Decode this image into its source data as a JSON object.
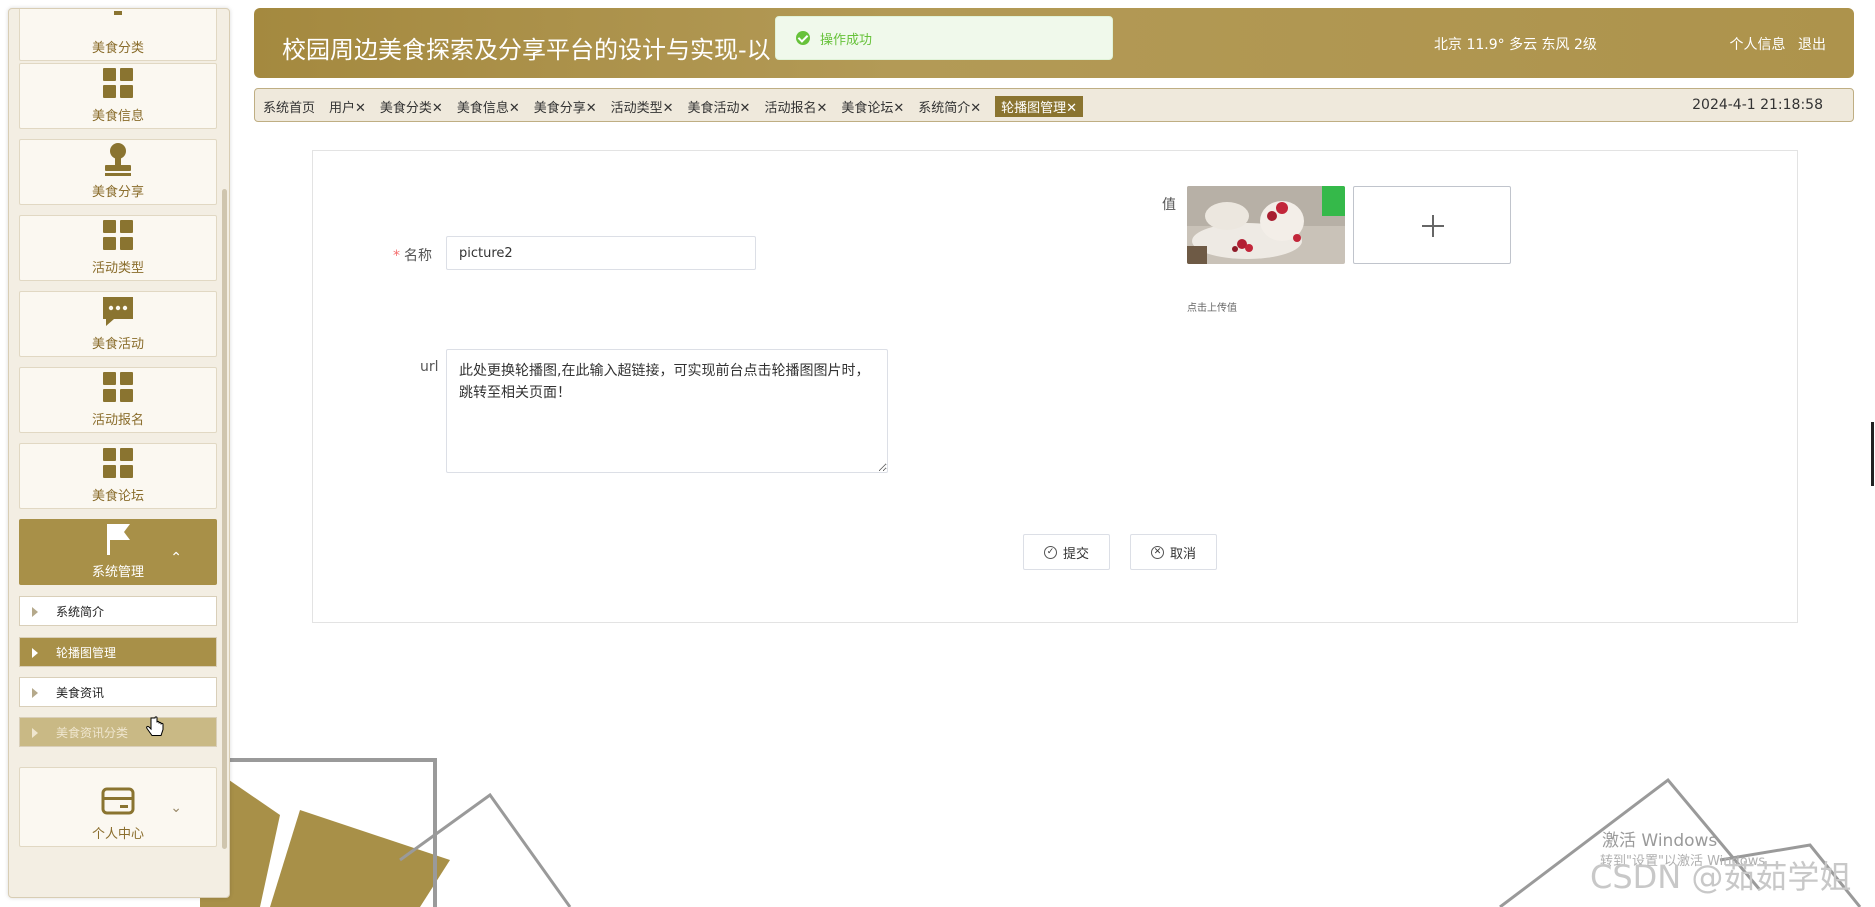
{
  "header": {
    "title": "校园周边美食探索及分享平台的设计与实现-以",
    "weather": "北京  11.9°  多云  东风  2级",
    "profile_link": "个人信息",
    "logout_link": "退出"
  },
  "toast": {
    "message": "操作成功"
  },
  "tabs": [
    {
      "label": "系统首页"
    },
    {
      "label": "用户✕"
    },
    {
      "label": "美食分类✕"
    },
    {
      "label": "美食信息✕"
    },
    {
      "label": "美食分享✕"
    },
    {
      "label": "活动类型✕"
    },
    {
      "label": "美食活动✕"
    },
    {
      "label": "活动报名✕"
    },
    {
      "label": "美食论坛✕"
    },
    {
      "label": "系统简介✕"
    },
    {
      "label": "轮播图管理✕"
    }
  ],
  "datetime": "2024-4-1 21:18:58",
  "sidebar": {
    "items": [
      {
        "label": "美食分类",
        "icon": "menu-icon"
      },
      {
        "label": "美食信息",
        "icon": "grid-icon"
      },
      {
        "label": "美食分享",
        "icon": "stamp-icon"
      },
      {
        "label": "活动类型",
        "icon": "grid-icon"
      },
      {
        "label": "美食活动",
        "icon": "chat-icon"
      },
      {
        "label": "活动报名",
        "icon": "grid-icon"
      },
      {
        "label": "美食论坛",
        "icon": "grid-icon"
      },
      {
        "label": "系统管理",
        "icon": "flag-icon",
        "chevron": "⌃"
      },
      {
        "label": "个人中心",
        "icon": "card-icon",
        "chevron": "⌄"
      }
    ],
    "sub_items": [
      {
        "label": "系统简介"
      },
      {
        "label": "轮播图管理"
      },
      {
        "label": "美食资讯"
      },
      {
        "label": "美食资讯分类"
      }
    ]
  },
  "form": {
    "name_label": "名称",
    "required_mark": "*",
    "name_value": "picture2",
    "url_label": "url",
    "url_value": "此处更换轮播图,在此输入超链接，可实现前台点击轮播图图片时，跳转至相关页面！",
    "value_label": "值",
    "upload_hint": "点击上传值",
    "submit_label": "提交",
    "cancel_label": "取消"
  },
  "overlay": {
    "activate_windows": "激活 Windows",
    "activate_hint": "转到\"设置\"以激活 Windows",
    "csdn_mark": "CSDN @茹茹学姐"
  },
  "colors": {
    "accent": "#a89048",
    "success": "#67c23a"
  }
}
